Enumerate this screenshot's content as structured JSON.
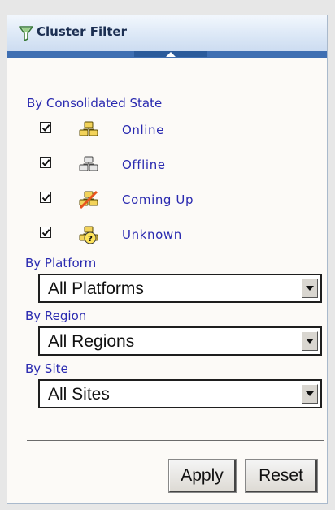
{
  "panel": {
    "title": "Cluster Filter",
    "icon": "filter-funnel-icon"
  },
  "consolidated_state": {
    "label": "By Consolidated State",
    "items": [
      {
        "label": "Online",
        "checked": true,
        "icon": "cluster-online-icon"
      },
      {
        "label": "Offline",
        "checked": true,
        "icon": "cluster-offline-icon"
      },
      {
        "label": "Coming Up",
        "checked": true,
        "icon": "cluster-coming-up-icon"
      },
      {
        "label": "Unknown",
        "checked": true,
        "icon": "cluster-unknown-icon"
      }
    ]
  },
  "platform": {
    "label": "By Platform",
    "selected": "All Platforms"
  },
  "region": {
    "label": "By Region",
    "selected": "All Regions"
  },
  "site": {
    "label": "By Site",
    "selected": "All Sites"
  },
  "actions": {
    "apply": "Apply",
    "reset": "Reset"
  }
}
